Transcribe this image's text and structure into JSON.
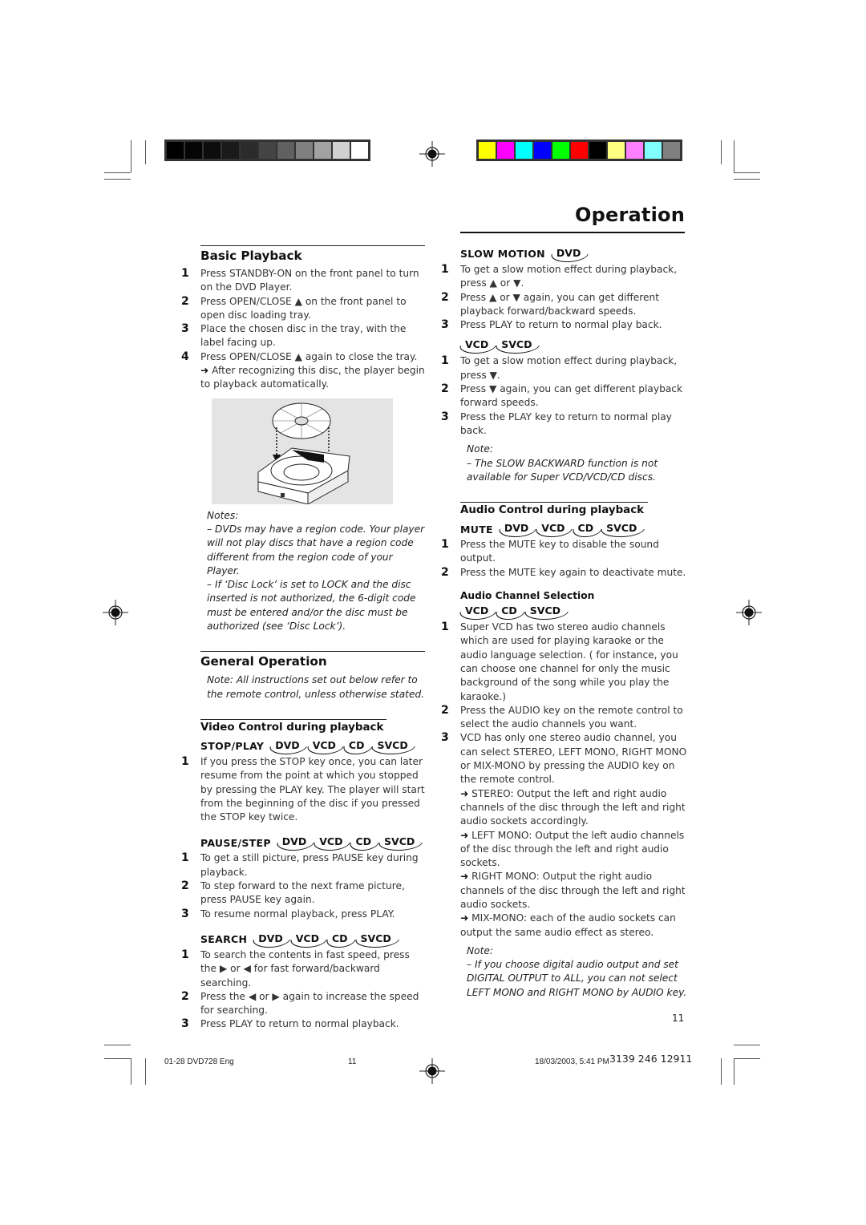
{
  "print_marks": {
    "grayscale_swatches": [
      "#000000",
      "#050505",
      "#0d0d0d",
      "#1a1a1a",
      "#2b2b2b",
      "#444444",
      "#606060",
      "#808080",
      "#a2a2a2",
      "#d0d0d0",
      "#ffffff"
    ],
    "color_swatches": [
      "#ffff00",
      "#ff00ff",
      "#00ffff",
      "#0000ff",
      "#00ff00",
      "#ff0000",
      "#000000",
      "#ffff80",
      "#ff80ff",
      "#80ffff",
      "#808080"
    ]
  },
  "header": {
    "title": "Operation"
  },
  "left_column": {
    "basic_playback": {
      "title": "Basic Playback",
      "steps": [
        {
          "num": "1",
          "text": "Press STANDBY-ON on the front panel to turn on the DVD Player."
        },
        {
          "num": "2",
          "text": "Press OPEN/CLOSE ▲ on the front panel to open disc loading tray."
        },
        {
          "num": "3",
          "text": "Place the chosen disc in the tray, with the label facing up."
        },
        {
          "num": "4",
          "text": "Press OPEN/CLOSE ▲ again to close the tray.",
          "arrow": "➜",
          "sub": "After recognizing this disc, the player begin to playback automatically."
        }
      ],
      "figure_label": "disc-tray-illustration",
      "notes_label": "Notes:",
      "notes": [
        "–   DVDs may have a region code. Your player will not play discs that have a region code different from the region code of  your Player.",
        "–   If ‘Disc Lock’ is set to LOCK and the disc inserted is not authorized, the 6-digit code must be entered and/or the disc must be authorized (see ‘Disc Lock’)."
      ]
    },
    "general_operation": {
      "title": "General Operation",
      "note": "Note: All instructions set out below refer to the remote control, unless otherwise stated."
    },
    "video_control": {
      "title": "Video Control during playback",
      "stop_play": {
        "label": "STOP/PLAY",
        "badges": [
          "DVD",
          "VCD",
          "CD",
          "SVCD"
        ],
        "steps": [
          {
            "num": "1",
            "text": "If you press the STOP key once, you can later resume from the point at which you stopped by pressing the PLAY key. The player will start from the beginning of the disc if you pressed the STOP key twice."
          }
        ]
      },
      "pause_step": {
        "label": "PAUSE/STEP",
        "badges": [
          "DVD",
          "VCD",
          "CD",
          "SVCD"
        ],
        "steps": [
          {
            "num": "1",
            "text": "To get a still picture, press PAUSE key during playback."
          },
          {
            "num": "2",
            "text": "To step forward to the next frame picture, press PAUSE key again."
          },
          {
            "num": "3",
            "text": "To resume normal playback, press PLAY."
          }
        ]
      },
      "search": {
        "label": "SEARCH",
        "badges": [
          "DVD",
          "VCD",
          "CD",
          "SVCD"
        ],
        "steps": [
          {
            "num": "1",
            "text": "To search the contents in fast speed, press the ▶ or ◀ for fast forward/backward searching."
          },
          {
            "num": "2",
            "text": "Press the ◀ or ▶ again to increase the speed for searching."
          },
          {
            "num": "3",
            "text": "Press PLAY to return to normal playback."
          }
        ]
      }
    }
  },
  "right_column": {
    "slow_motion": {
      "label": "SLOW MOTION",
      "badges": [
        "DVD"
      ],
      "steps": [
        {
          "num": "1",
          "text": "To get a slow motion effect during playback, press ▲ or ▼."
        },
        {
          "num": "2",
          "text": "Press ▲ or ▼ again, you can get different playback forward/backward speeds."
        },
        {
          "num": "3",
          "text": "Press PLAY to return to normal play back."
        }
      ],
      "vcd_badges": [
        "VCD",
        "SVCD"
      ],
      "vcd_steps": [
        {
          "num": "1",
          "text": "To get a slow motion effect during playback, press ▼."
        },
        {
          "num": "2",
          "text": "Press ▼ again, you can get different playback forward speeds."
        },
        {
          "num": "3",
          "text": "Press the PLAY key to return to normal play back."
        }
      ],
      "note_label": "Note:",
      "note": "–   The SLOW BACKWARD function is not available for Super VCD/VCD/CD discs."
    },
    "audio_control": {
      "title": "Audio Control during playback",
      "mute": {
        "label": "MUTE",
        "badges": [
          "DVD",
          "VCD",
          "CD",
          "SVCD"
        ],
        "steps": [
          {
            "num": "1",
            "text": "Press the MUTE key to disable the sound output."
          },
          {
            "num": "2",
            "text": "Press the MUTE key again to deactivate mute."
          }
        ]
      },
      "channel_selection": {
        "title": "Audio Channel Selection",
        "badges": [
          "VCD",
          "CD",
          "SVCD"
        ],
        "steps": [
          {
            "num": "1",
            "text": "Super VCD has two stereo audio channels which are used for playing karaoke or the audio language selection. ( for instance, you can choose one channel for only the music background of the song while you play the karaoke.)"
          },
          {
            "num": "2",
            "text": "Press the AUDIO key on the remote control to select the audio channels you want."
          },
          {
            "num": "3",
            "text": "VCD has only one stereo audio channel, you can select STEREO, LEFT MONO, RIGHT MONO or MIX-MONO by pressing the AUDIO key on the remote control."
          }
        ],
        "arrow": "➜",
        "options": [
          "STEREO: Output the left and right audio channels of the disc through the left and right audio sockets accordingly.",
          "LEFT MONO: Output the left audio channels of the disc through the left and right audio sockets.",
          "RIGHT MONO: Output the right audio channels of the disc through the left and right audio sockets.",
          "MIX-MONO: each of the audio sockets can output the same audio effect as stereo."
        ],
        "note_label": "Note:",
        "note": "–   If you choose digital audio output and set DIGITAL OUTPUT to ALL, you can not select LEFT MONO and RIGHT MONO by AUDIO key."
      }
    }
  },
  "footer": {
    "page_number": "11",
    "file_name": "01-28 DVD728 Eng",
    "file_page": "11",
    "timestamp": "18/03/2003, 5:41 PM",
    "product_code": "3139 246 12911"
  }
}
